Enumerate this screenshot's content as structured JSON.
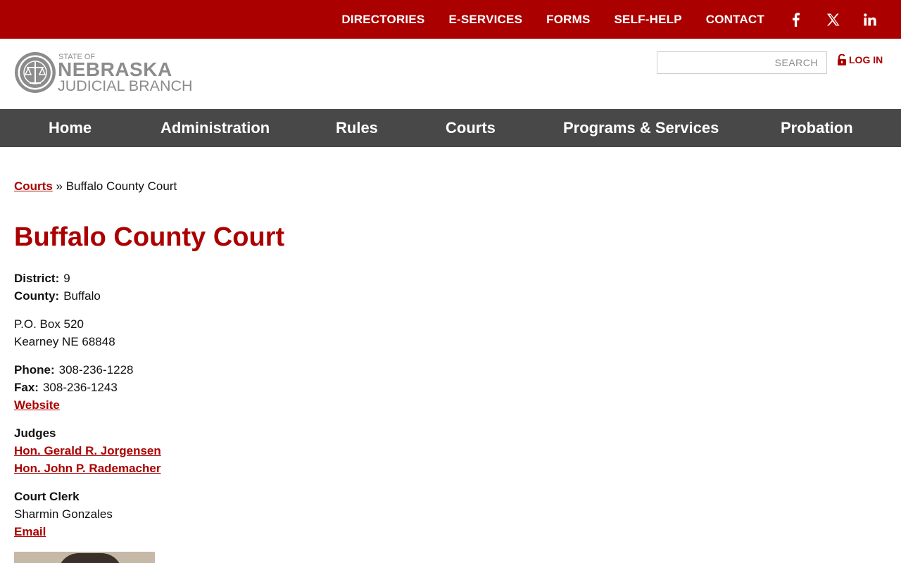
{
  "top_nav": {
    "links": [
      "DIRECTORIES",
      "E-SERVICES",
      "FORMS",
      "SELF-HELP",
      "CONTACT"
    ],
    "social": [
      "facebook-icon",
      "x-twitter-icon",
      "linkedin-icon"
    ]
  },
  "header": {
    "logo": {
      "line1": "STATE OF",
      "line2": "NEBRASKA",
      "line3": "JUDICIAL BRANCH"
    },
    "search_placeholder": "SEARCH",
    "login_label": "LOG IN"
  },
  "main_nav": {
    "items": [
      "Home",
      "Administration",
      "Rules",
      "Courts",
      "Programs & Services",
      "Probation"
    ]
  },
  "breadcrumb": {
    "parent": "Courts",
    "separator": "»",
    "current": "Buffalo County Court"
  },
  "page": {
    "title": "Buffalo County Court",
    "district_label": "District:",
    "district_value": "9",
    "county_label": "County:",
    "county_value": "Buffalo",
    "address_line1": "P.O. Box 520",
    "address_line2": "Kearney NE 68848",
    "phone_label": "Phone:",
    "phone_value": "308-236-1228",
    "fax_label": "Fax:",
    "fax_value": "308-236-1243",
    "website_label": "Website",
    "judges_heading": "Judges",
    "judges": [
      "Hon. Gerald R. Jorgensen",
      "Hon. John P. Rademacher"
    ],
    "clerk_heading": "Court Clerk",
    "clerk_name": "Sharmin Gonzales",
    "clerk_email_label": "Email"
  },
  "colors": {
    "brand_red": "#ab0000",
    "nav_gray": "#484848",
    "logo_gray": "#8c8c8c"
  }
}
